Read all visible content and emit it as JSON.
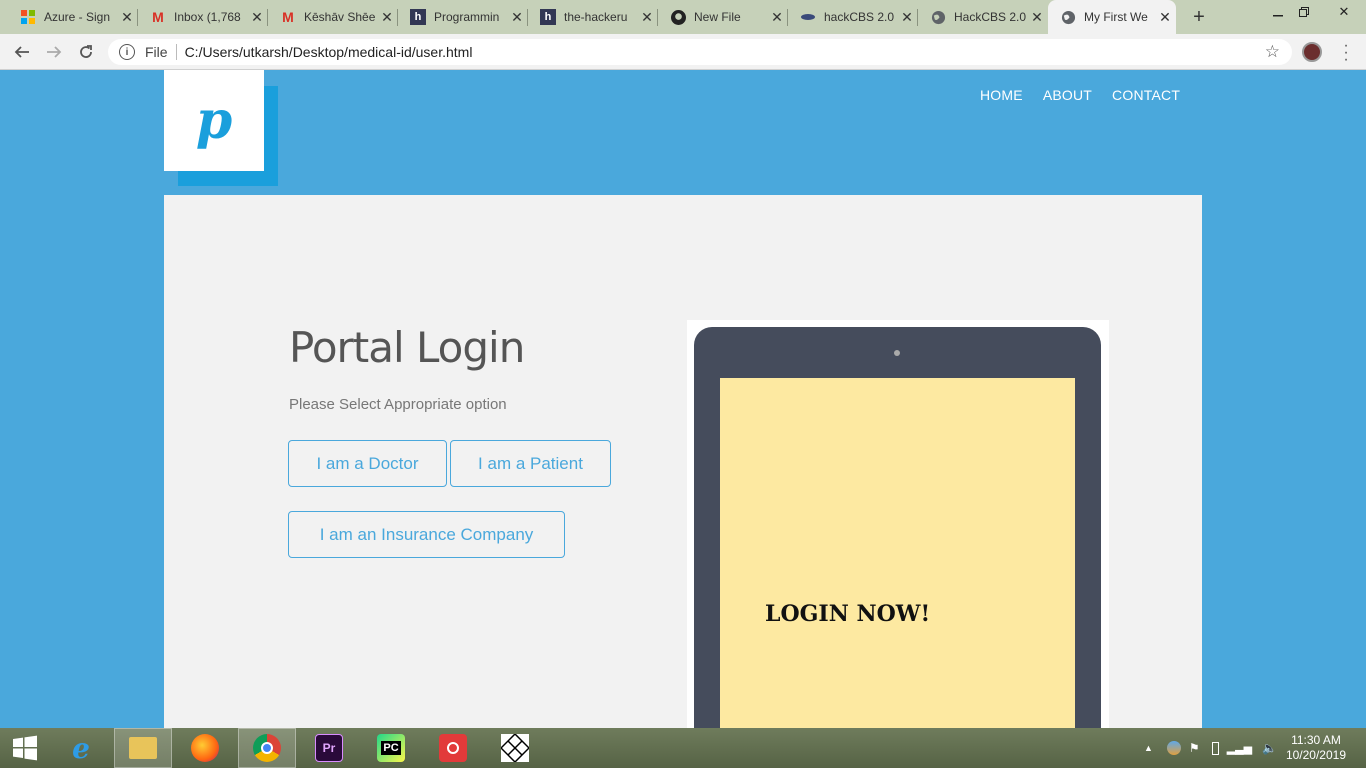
{
  "browser": {
    "tabs": [
      {
        "title": "Azure - Sign",
        "icon": "microsoft-icon"
      },
      {
        "title": "Inbox (1,768",
        "icon": "gmail-icon"
      },
      {
        "title": "Kēshāv Shēe",
        "icon": "gmail-icon"
      },
      {
        "title": "Programmin",
        "icon": "hackerearth-icon"
      },
      {
        "title": "the-hackeru",
        "icon": "hackerearth-icon"
      },
      {
        "title": "New File",
        "icon": "github-icon"
      },
      {
        "title": "hackCBS 2.0",
        "icon": "hackcbs-icon"
      },
      {
        "title": "HackCBS 2.0",
        "icon": "globe-icon"
      },
      {
        "title": "My First We",
        "icon": "globe-icon"
      }
    ],
    "address": {
      "scheme_label": "File",
      "url": "C:/Users/utkarsh/Desktop/medical-id/user.html"
    }
  },
  "site": {
    "logo_letter": "p",
    "nav": [
      "HOME",
      "ABOUT",
      "CONTACT"
    ],
    "heading": "Portal Login",
    "subtext": "Please Select Appropriate option",
    "buttons": {
      "doctor": "I am a Doctor",
      "patient": "I am a Patient",
      "insurance": "I am an Insurance Company"
    },
    "device_text": "LOGIN NOW!"
  },
  "colors": {
    "page_bg": "#4aa8dc",
    "accent": "#1a9fdc",
    "device_body": "#454c5c",
    "device_screen": "#fde9a1"
  },
  "taskbar": {
    "apps": [
      "start-icon",
      "internet-explorer-icon",
      "file-explorer-icon",
      "firefox-icon",
      "chrome-icon",
      "premiere-pro-icon",
      "pycharm-icon",
      "camera-app-icon",
      "pattern-app-icon"
    ],
    "time": "11:30 AM",
    "date": "10/20/2019"
  }
}
